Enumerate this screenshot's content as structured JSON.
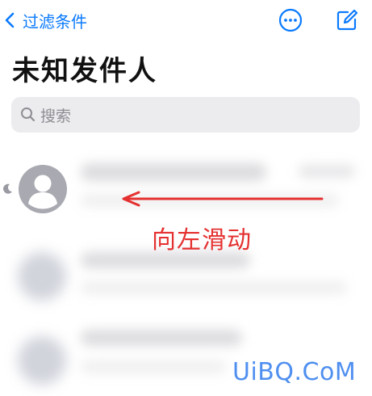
{
  "navbar": {
    "back_label": "过滤条件",
    "back_icon": "chevron-left-icon",
    "more_icon": "ellipsis-circle-icon",
    "compose_icon": "compose-icon"
  },
  "page": {
    "title": "未知发件人"
  },
  "search": {
    "placeholder": "搜索",
    "icon": "magnifier-icon"
  },
  "annotation": {
    "text": "向左滑动",
    "color": "#e53030"
  },
  "watermark": {
    "text": "UiBQ.CoM",
    "color": "#4f8ff0"
  },
  "colors": {
    "accent": "#0a7aff",
    "avatar": "#a9aab1"
  }
}
